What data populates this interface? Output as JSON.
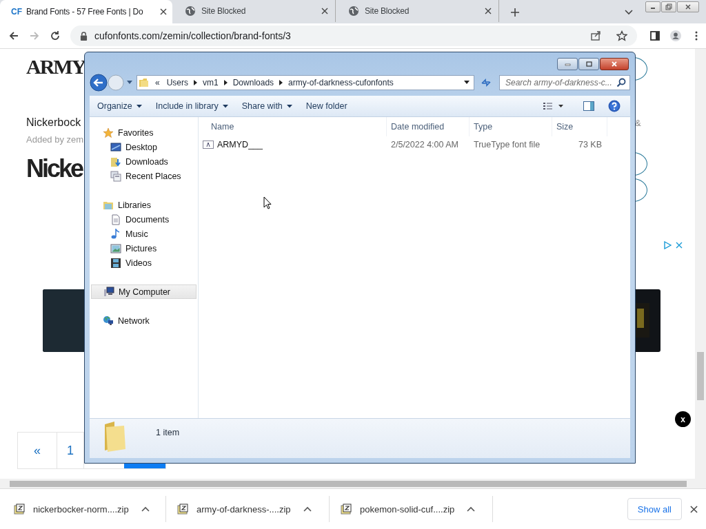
{
  "browser": {
    "tabs": [
      {
        "favicon": "CF",
        "label": "Brand Fonts - 57 Free Fonts | Do",
        "selected": true
      },
      {
        "label": "Site Blocked",
        "selected": false
      },
      {
        "label": "Site Blocked",
        "selected": false
      }
    ],
    "url": "cufonfonts.com/zemin/collection/brand-fonts/3"
  },
  "page": {
    "heading": "ARMY",
    "font_title": "Nickerbock",
    "added_by": "Added by zem",
    "font_preview": "Nicke",
    "ampersand": "&",
    "pagination": [
      {
        "label": "«",
        "selected": false
      },
      {
        "label": "1",
        "selected": false
      }
    ],
    "close_badge": "x"
  },
  "explorer": {
    "breadcrumb_overflow": "«",
    "path": [
      "Users",
      "vm1",
      "Downloads",
      "army-of-darkness-cufonfonts"
    ],
    "search": {
      "placeholder": "Search army-of-darkness-c..."
    },
    "commands": [
      {
        "label": "Organize",
        "dropdown": true
      },
      {
        "label": "Include in library",
        "dropdown": true
      },
      {
        "label": "Share with",
        "dropdown": true
      },
      {
        "label": "New folder",
        "dropdown": false
      }
    ],
    "nav": [
      {
        "label": "Favorites",
        "kind": "star",
        "selected": false,
        "children": [
          {
            "label": "Desktop",
            "kind": "desktop",
            "selected": false
          },
          {
            "label": "Downloads",
            "kind": "downloads",
            "selected": false
          },
          {
            "label": "Recent Places",
            "kind": "recent",
            "selected": false
          }
        ]
      },
      {
        "label": "Libraries",
        "kind": "library",
        "selected": false,
        "children": [
          {
            "label": "Documents",
            "kind": "document",
            "selected": false
          },
          {
            "label": "Music",
            "kind": "music",
            "selected": false
          },
          {
            "label": "Pictures",
            "kind": "pictures",
            "selected": false
          },
          {
            "label": "Videos",
            "kind": "videos",
            "selected": false
          }
        ]
      },
      {
        "label": "My Computer",
        "kind": "computer",
        "selected": true
      },
      {
        "label": "Network",
        "kind": "network",
        "selected": false
      }
    ],
    "columns": [
      "Name",
      "Date modified",
      "Type",
      "Size"
    ],
    "files": [
      {
        "name": "ARMYD___",
        "date": "2/5/2022 4:00 AM",
        "type": "TrueType font file",
        "size": "73 KB"
      }
    ],
    "status": "1 item"
  },
  "downloads": {
    "items": [
      {
        "name": "nickerbocker-norm....zip"
      },
      {
        "name": "army-of-darkness-....zip"
      },
      {
        "name": "pokemon-solid-cuf....zip"
      }
    ],
    "show_all": "Show all"
  }
}
